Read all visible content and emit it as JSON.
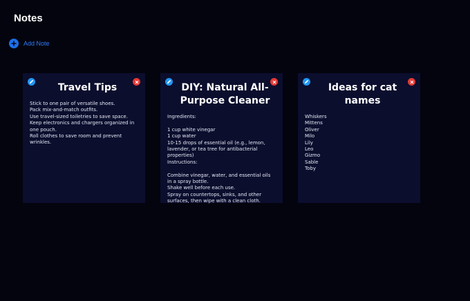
{
  "header": {
    "title": "Notes"
  },
  "toolbar": {
    "add_note_label": "Add Note",
    "add_icon": "plus-circle-icon"
  },
  "colors": {
    "background": "#04040f",
    "card": "#0b0e2d",
    "accent": "#2f7df2",
    "edit": "#2196f3",
    "delete": "#e53935"
  },
  "notes": [
    {
      "title": "Travel Tips",
      "lines": [
        "Stick to one pair of versatile shoes.",
        "Pack mix-and-match outfits.",
        "Use travel-sized toiletries to save space.",
        "Keep electronics and chargers organized in one pouch.",
        "Roll clothes to save room and prevent wrinkles."
      ]
    },
    {
      "title": "DIY: Natural All-Purpose Cleaner",
      "lines": [
        "Ingredients:",
        "",
        "1 cup white vinegar",
        "1 cup water",
        "10-15 drops of essential oil (e.g., lemon, lavender, or tea tree for antibacterial properties)",
        "Instructions:",
        "",
        "Combine vinegar, water, and essential oils in a spray bottle.",
        "Shake well before each use.",
        "Spray on countertops, sinks, and other surfaces, then wipe with a clean cloth."
      ]
    },
    {
      "title": "Ideas for cat names",
      "lines": [
        "Whiskers",
        "Mittens",
        "Oliver",
        "Milo",
        "Lily",
        "Leo",
        "Gizmo",
        "Sable",
        "Toby"
      ]
    }
  ]
}
